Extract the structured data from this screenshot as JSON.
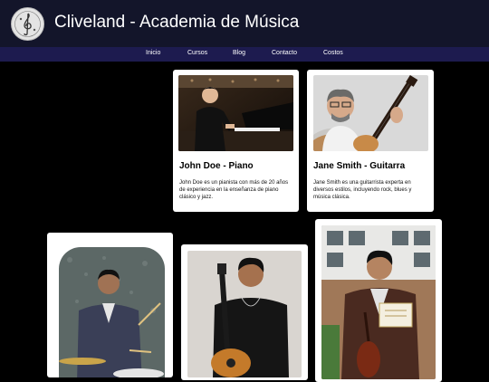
{
  "site": {
    "title": "Cliveland - Academia de Música"
  },
  "nav": [
    {
      "label": "Inicio"
    },
    {
      "label": "Cursos"
    },
    {
      "label": "Blog"
    },
    {
      "label": "Contacto"
    },
    {
      "label": "Costos"
    }
  ],
  "teachers": [
    {
      "name": "John Doe - Piano",
      "bio": "John Doe es un pianista con más de 20 años de experiencia en la enseñanza de piano clásico y jazz.",
      "photo_icon": "pianist-photo"
    },
    {
      "name": "Jane Smith - Guitarra",
      "bio": "Jane Smith es una guitarrista experta en diversos estilos, incluyendo rock, blues y música clásica.",
      "photo_icon": "guitarist-photo"
    },
    {
      "photo_icon": "drummer-photo"
    },
    {
      "photo_icon": "guitar-student-photo"
    },
    {
      "photo_icon": "violinist-photo"
    }
  ],
  "colors": {
    "header_bg": "#13152a",
    "nav_bg": "#1d1b4f",
    "page_bg": "#000000",
    "card_bg": "#ffffff"
  }
}
